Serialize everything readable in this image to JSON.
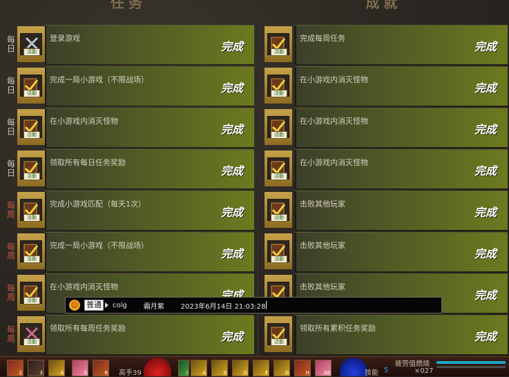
{
  "headers": {
    "left": "任务",
    "right": "成就"
  },
  "left_tasks": [
    {
      "freq": "每日",
      "type": "daily",
      "label": "登录游戏",
      "status": "完成",
      "icon": "crossed-sword-icon"
    },
    {
      "freq": "每日",
      "type": "daily",
      "label": "完成一局小游戏（不限战场）",
      "status": "完成",
      "icon": "checkmark-icon"
    },
    {
      "freq": "每日",
      "type": "daily",
      "label": "在小游戏内消灭怪物",
      "status": "完成",
      "icon": "checkmark-icon"
    },
    {
      "freq": "每日",
      "type": "daily",
      "label": "领取所有每日任务奖励",
      "status": "完成",
      "icon": "checkmark-icon"
    },
    {
      "freq": "每周",
      "type": "weekly",
      "label": "完成小游戏匹配（每天1次）",
      "status": "完成",
      "icon": "checkmark-icon"
    },
    {
      "freq": "每周",
      "type": "weekly",
      "label": "完成一局小游戏（不限战场）",
      "status": "完成",
      "icon": "checkmark-icon"
    },
    {
      "freq": "每周",
      "type": "weekly",
      "label": "在小游戏内消灭怪物",
      "status": "完成",
      "icon": "checkmark-icon"
    },
    {
      "freq": "每周",
      "type": "weekly",
      "label": "领取所有每周任务奖励",
      "status": "完成",
      "icon": "crossed-sword-icon"
    }
  ],
  "right_tasks": [
    {
      "label": "完成每周任务",
      "status": "完成",
      "icon": "checkmark-icon"
    },
    {
      "label": "在小游戏内消灭怪物",
      "status": "完成",
      "icon": "checkmark-icon"
    },
    {
      "label": "在小游戏内消灭怪物",
      "status": "完成",
      "icon": "checkmark-icon"
    },
    {
      "label": "在小游戏内消灭怪物",
      "status": "完成",
      "icon": "checkmark-icon"
    },
    {
      "label": "击败其他玩家",
      "status": "完成",
      "icon": "checkmark-icon"
    },
    {
      "label": "击败其他玩家",
      "status": "完成",
      "icon": "checkmark-icon"
    },
    {
      "label": "击败其他玩家",
      "status": "完成",
      "icon": "checkmark-icon"
    },
    {
      "label": "领取所有累积任务奖励",
      "status": "完成",
      "icon": "checkmark-icon"
    }
  ],
  "icon_tag": "活動",
  "tooltip": {
    "channel": "普通",
    "name": "colg",
    "name2": "霜月紫",
    "time": "2023年6月14日 21:03:28"
  },
  "bottom_bar": {
    "level_text": "高手39",
    "skill_label": "技能",
    "skill_count": "5",
    "fatigue_label": "疲劳值燃烧",
    "coin_text": "×027",
    "slot_keys": [
      "2",
      "3",
      "4",
      "5",
      "6",
      "",
      "",
      "I",
      "A",
      "S",
      "D",
      "F",
      "G",
      "H",
      "Alt"
    ]
  },
  "colors": {
    "bar_start": "#3c3f2a",
    "bar_end": "#6c7a1f",
    "daily_text": "#cfc7b8",
    "weekly_text": "#c35a3e",
    "frame_gold": "#c6a24a"
  }
}
